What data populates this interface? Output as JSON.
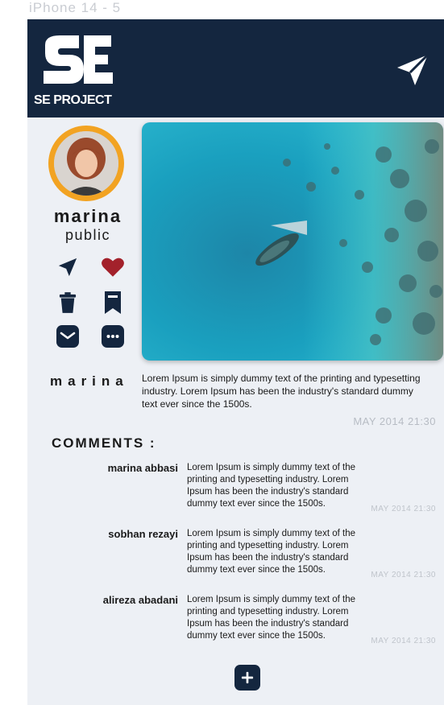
{
  "device_label": "iPhone 14 - 5",
  "header": {
    "logo_text": "SE PROJECT",
    "send_icon": "send-icon"
  },
  "profile": {
    "username": "marina",
    "visibility": "public",
    "actions": [
      {
        "name": "send",
        "icon": "send-icon"
      },
      {
        "name": "like",
        "icon": "heart-icon"
      },
      {
        "name": "delete",
        "icon": "trash-icon"
      },
      {
        "name": "bookmark",
        "icon": "bookmark-icon"
      },
      {
        "name": "message",
        "icon": "mail-icon"
      },
      {
        "name": "more",
        "icon": "more-icon"
      }
    ]
  },
  "post": {
    "author": "marina",
    "caption": "Lorem Ipsum is simply dummy text of the printing and typesetting industry. Lorem Ipsum has been the industry's standard dummy text ever since the 1500s.",
    "date": "MAY 2014 21:30"
  },
  "comments": {
    "title": "COMMENTS :",
    "items": [
      {
        "author": "marina abbasi",
        "text": "Lorem Ipsum is simply dummy text of the printing and typesetting industry. Lorem Ipsum has been the industry's standard dummy text ever since the 1500s.",
        "date": "MAY 2014 21:30"
      },
      {
        "author": "sobhan rezayi",
        "text": "Lorem Ipsum is simply dummy text of the printing and typesetting industry. Lorem Ipsum has been the industry's standard dummy text ever since the 1500s.",
        "date": "MAY 2014 21:30"
      },
      {
        "author": "alireza abadani",
        "text": "Lorem Ipsum is simply dummy text of the printing and typesetting industry. Lorem Ipsum has been the industry's standard dummy text ever since the 1500s.",
        "date": "MAY 2014 21:30"
      }
    ]
  },
  "colors": {
    "header": "#14263f",
    "accent_ring": "#f2a322",
    "heart": "#a3212b",
    "icon": "#14263f"
  }
}
